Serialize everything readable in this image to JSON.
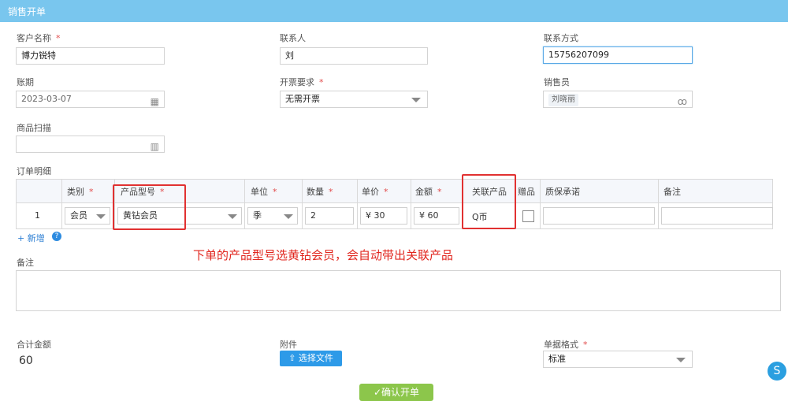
{
  "header": {
    "title": "销售开单"
  },
  "form": {
    "customer": {
      "label": "客户名称",
      "value": "博力锐特"
    },
    "contact": {
      "label": "联系人",
      "value": "刘"
    },
    "phone": {
      "label": "联系方式",
      "value": "15756207099"
    },
    "period": {
      "label": "账期",
      "value": "2023-03-07"
    },
    "invoice": {
      "label": "开票要求",
      "value": "无需开票"
    },
    "salesperson": {
      "label": "销售员",
      "value": "刘晓丽"
    },
    "scan": {
      "label": "商品扫描",
      "value": ""
    }
  },
  "order": {
    "label": "订单明细",
    "columns": [
      "类别",
      "产品型号",
      "单位",
      "数量",
      "单价",
      "金额",
      "关联产品",
      "赠品",
      "质保承诺",
      "备注"
    ],
    "rows": [
      {
        "index": "1",
        "category": "会员",
        "model": "黄钻会员",
        "unit": "季",
        "qty": "2",
        "price": "¥ 30",
        "amount": "¥ 60",
        "related": "Q币",
        "gift_checked": false,
        "warranty": "",
        "remark": ""
      }
    ],
    "add_label": "+ 新增"
  },
  "annotation": "下单的产品型号选黄钻会员，会自动带出关联产品",
  "remark_label": "备注",
  "total": {
    "label": "合计金额",
    "value": "60"
  },
  "attachment": {
    "label": "附件",
    "button": "选择文件"
  },
  "doc_format": {
    "label": "单据格式",
    "value": "标准"
  },
  "confirm_button": "✓确认开单",
  "colors": {
    "header": "#79c6ee",
    "primary": "#2d9ae8",
    "confirm": "#8cc64b",
    "alert": "#e13131"
  }
}
